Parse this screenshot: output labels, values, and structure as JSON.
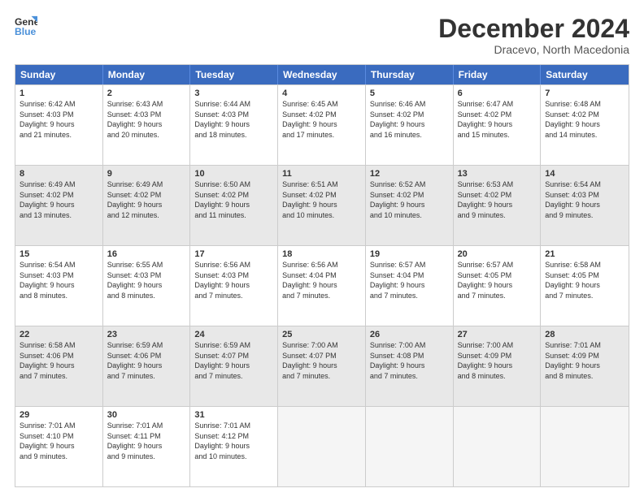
{
  "logo": {
    "line1": "General",
    "line2": "Blue"
  },
  "title": "December 2024",
  "subtitle": "Dracevo, North Macedonia",
  "header_days": [
    "Sunday",
    "Monday",
    "Tuesday",
    "Wednesday",
    "Thursday",
    "Friday",
    "Saturday"
  ],
  "rows": [
    [
      {
        "day": "1",
        "lines": [
          "Sunrise: 6:42 AM",
          "Sunset: 4:03 PM",
          "Daylight: 9 hours",
          "and 21 minutes."
        ],
        "shaded": false
      },
      {
        "day": "2",
        "lines": [
          "Sunrise: 6:43 AM",
          "Sunset: 4:03 PM",
          "Daylight: 9 hours",
          "and 20 minutes."
        ],
        "shaded": false
      },
      {
        "day": "3",
        "lines": [
          "Sunrise: 6:44 AM",
          "Sunset: 4:03 PM",
          "Daylight: 9 hours",
          "and 18 minutes."
        ],
        "shaded": false
      },
      {
        "day": "4",
        "lines": [
          "Sunrise: 6:45 AM",
          "Sunset: 4:02 PM",
          "Daylight: 9 hours",
          "and 17 minutes."
        ],
        "shaded": false
      },
      {
        "day": "5",
        "lines": [
          "Sunrise: 6:46 AM",
          "Sunset: 4:02 PM",
          "Daylight: 9 hours",
          "and 16 minutes."
        ],
        "shaded": false
      },
      {
        "day": "6",
        "lines": [
          "Sunrise: 6:47 AM",
          "Sunset: 4:02 PM",
          "Daylight: 9 hours",
          "and 15 minutes."
        ],
        "shaded": false
      },
      {
        "day": "7",
        "lines": [
          "Sunrise: 6:48 AM",
          "Sunset: 4:02 PM",
          "Daylight: 9 hours",
          "and 14 minutes."
        ],
        "shaded": false
      }
    ],
    [
      {
        "day": "8",
        "lines": [
          "Sunrise: 6:49 AM",
          "Sunset: 4:02 PM",
          "Daylight: 9 hours",
          "and 13 minutes."
        ],
        "shaded": true
      },
      {
        "day": "9",
        "lines": [
          "Sunrise: 6:49 AM",
          "Sunset: 4:02 PM",
          "Daylight: 9 hours",
          "and 12 minutes."
        ],
        "shaded": true
      },
      {
        "day": "10",
        "lines": [
          "Sunrise: 6:50 AM",
          "Sunset: 4:02 PM",
          "Daylight: 9 hours",
          "and 11 minutes."
        ],
        "shaded": true
      },
      {
        "day": "11",
        "lines": [
          "Sunrise: 6:51 AM",
          "Sunset: 4:02 PM",
          "Daylight: 9 hours",
          "and 10 minutes."
        ],
        "shaded": true
      },
      {
        "day": "12",
        "lines": [
          "Sunrise: 6:52 AM",
          "Sunset: 4:02 PM",
          "Daylight: 9 hours",
          "and 10 minutes."
        ],
        "shaded": true
      },
      {
        "day": "13",
        "lines": [
          "Sunrise: 6:53 AM",
          "Sunset: 4:02 PM",
          "Daylight: 9 hours",
          "and 9 minutes."
        ],
        "shaded": true
      },
      {
        "day": "14",
        "lines": [
          "Sunrise: 6:54 AM",
          "Sunset: 4:03 PM",
          "Daylight: 9 hours",
          "and 9 minutes."
        ],
        "shaded": true
      }
    ],
    [
      {
        "day": "15",
        "lines": [
          "Sunrise: 6:54 AM",
          "Sunset: 4:03 PM",
          "Daylight: 9 hours",
          "and 8 minutes."
        ],
        "shaded": false
      },
      {
        "day": "16",
        "lines": [
          "Sunrise: 6:55 AM",
          "Sunset: 4:03 PM",
          "Daylight: 9 hours",
          "and 8 minutes."
        ],
        "shaded": false
      },
      {
        "day": "17",
        "lines": [
          "Sunrise: 6:56 AM",
          "Sunset: 4:03 PM",
          "Daylight: 9 hours",
          "and 7 minutes."
        ],
        "shaded": false
      },
      {
        "day": "18",
        "lines": [
          "Sunrise: 6:56 AM",
          "Sunset: 4:04 PM",
          "Daylight: 9 hours",
          "and 7 minutes."
        ],
        "shaded": false
      },
      {
        "day": "19",
        "lines": [
          "Sunrise: 6:57 AM",
          "Sunset: 4:04 PM",
          "Daylight: 9 hours",
          "and 7 minutes."
        ],
        "shaded": false
      },
      {
        "day": "20",
        "lines": [
          "Sunrise: 6:57 AM",
          "Sunset: 4:05 PM",
          "Daylight: 9 hours",
          "and 7 minutes."
        ],
        "shaded": false
      },
      {
        "day": "21",
        "lines": [
          "Sunrise: 6:58 AM",
          "Sunset: 4:05 PM",
          "Daylight: 9 hours",
          "and 7 minutes."
        ],
        "shaded": false
      }
    ],
    [
      {
        "day": "22",
        "lines": [
          "Sunrise: 6:58 AM",
          "Sunset: 4:06 PM",
          "Daylight: 9 hours",
          "and 7 minutes."
        ],
        "shaded": true
      },
      {
        "day": "23",
        "lines": [
          "Sunrise: 6:59 AM",
          "Sunset: 4:06 PM",
          "Daylight: 9 hours",
          "and 7 minutes."
        ],
        "shaded": true
      },
      {
        "day": "24",
        "lines": [
          "Sunrise: 6:59 AM",
          "Sunset: 4:07 PM",
          "Daylight: 9 hours",
          "and 7 minutes."
        ],
        "shaded": true
      },
      {
        "day": "25",
        "lines": [
          "Sunrise: 7:00 AM",
          "Sunset: 4:07 PM",
          "Daylight: 9 hours",
          "and 7 minutes."
        ],
        "shaded": true
      },
      {
        "day": "26",
        "lines": [
          "Sunrise: 7:00 AM",
          "Sunset: 4:08 PM",
          "Daylight: 9 hours",
          "and 7 minutes."
        ],
        "shaded": true
      },
      {
        "day": "27",
        "lines": [
          "Sunrise: 7:00 AM",
          "Sunset: 4:09 PM",
          "Daylight: 9 hours",
          "and 8 minutes."
        ],
        "shaded": true
      },
      {
        "day": "28",
        "lines": [
          "Sunrise: 7:01 AM",
          "Sunset: 4:09 PM",
          "Daylight: 9 hours",
          "and 8 minutes."
        ],
        "shaded": true
      }
    ],
    [
      {
        "day": "29",
        "lines": [
          "Sunrise: 7:01 AM",
          "Sunset: 4:10 PM",
          "Daylight: 9 hours",
          "and 9 minutes."
        ],
        "shaded": false
      },
      {
        "day": "30",
        "lines": [
          "Sunrise: 7:01 AM",
          "Sunset: 4:11 PM",
          "Daylight: 9 hours",
          "and 9 minutes."
        ],
        "shaded": false
      },
      {
        "day": "31",
        "lines": [
          "Sunrise: 7:01 AM",
          "Sunset: 4:12 PM",
          "Daylight: 9 hours",
          "and 10 minutes."
        ],
        "shaded": false
      },
      {
        "day": "",
        "lines": [],
        "shaded": false,
        "empty": true
      },
      {
        "day": "",
        "lines": [],
        "shaded": false,
        "empty": true
      },
      {
        "day": "",
        "lines": [],
        "shaded": false,
        "empty": true
      },
      {
        "day": "",
        "lines": [],
        "shaded": false,
        "empty": true
      }
    ]
  ]
}
